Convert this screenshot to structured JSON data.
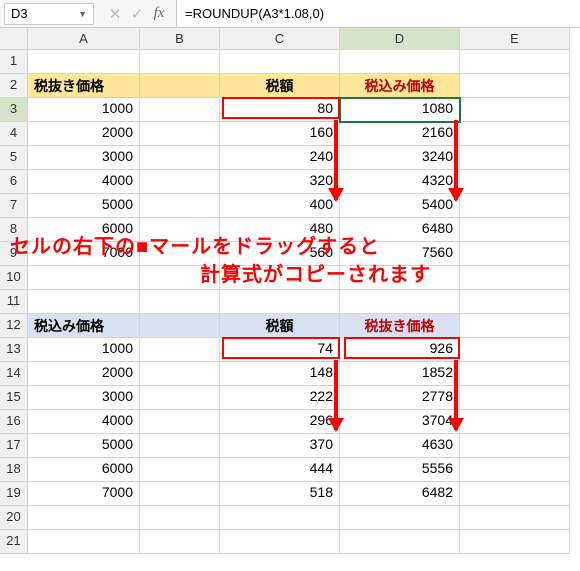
{
  "nameBox": {
    "value": "D3"
  },
  "formula": "=ROUNDUP(A3*1.08,0)",
  "colHeaders": [
    "A",
    "B",
    "C",
    "D",
    "E"
  ],
  "rowHeaders": [
    "1",
    "2",
    "3",
    "4",
    "5",
    "6",
    "7",
    "8",
    "9",
    "10",
    "11",
    "12",
    "13",
    "14",
    "15",
    "16",
    "17",
    "18",
    "19",
    "20",
    "21"
  ],
  "selectedCol": "D",
  "selectedRow": "3",
  "headerRow1": {
    "a": "税抜き価格",
    "c": "税額",
    "d": "税込み価格"
  },
  "table1": [
    {
      "a": "1000",
      "c": "80",
      "d": "1080"
    },
    {
      "a": "2000",
      "c": "160",
      "d": "2160"
    },
    {
      "a": "3000",
      "c": "240",
      "d": "3240"
    },
    {
      "a": "4000",
      "c": "320",
      "d": "4320"
    },
    {
      "a": "5000",
      "c": "400",
      "d": "5400"
    },
    {
      "a": "6000",
      "c": "480",
      "d": "6480"
    },
    {
      "a": "7000",
      "c": "560",
      "d": "7560"
    }
  ],
  "headerRow2": {
    "a": "税込み価格",
    "c": "税額",
    "d": "税抜き価格"
  },
  "table2": [
    {
      "a": "1000",
      "c": "74",
      "d": "926"
    },
    {
      "a": "2000",
      "c": "148",
      "d": "1852"
    },
    {
      "a": "3000",
      "c": "222",
      "d": "2778"
    },
    {
      "a": "4000",
      "c": "296",
      "d": "3704"
    },
    {
      "a": "5000",
      "c": "370",
      "d": "4630"
    },
    {
      "a": "6000",
      "c": "444",
      "d": "5556"
    },
    {
      "a": "7000",
      "c": "518",
      "d": "6482"
    }
  ],
  "annotation": {
    "line1": "セルの右下の■マールをドラッグすると",
    "line2": "計算式がコピーされます"
  },
  "icons": {
    "cancel": "✕",
    "confirm": "✓",
    "fx": "fx",
    "dropdown": "▼"
  }
}
